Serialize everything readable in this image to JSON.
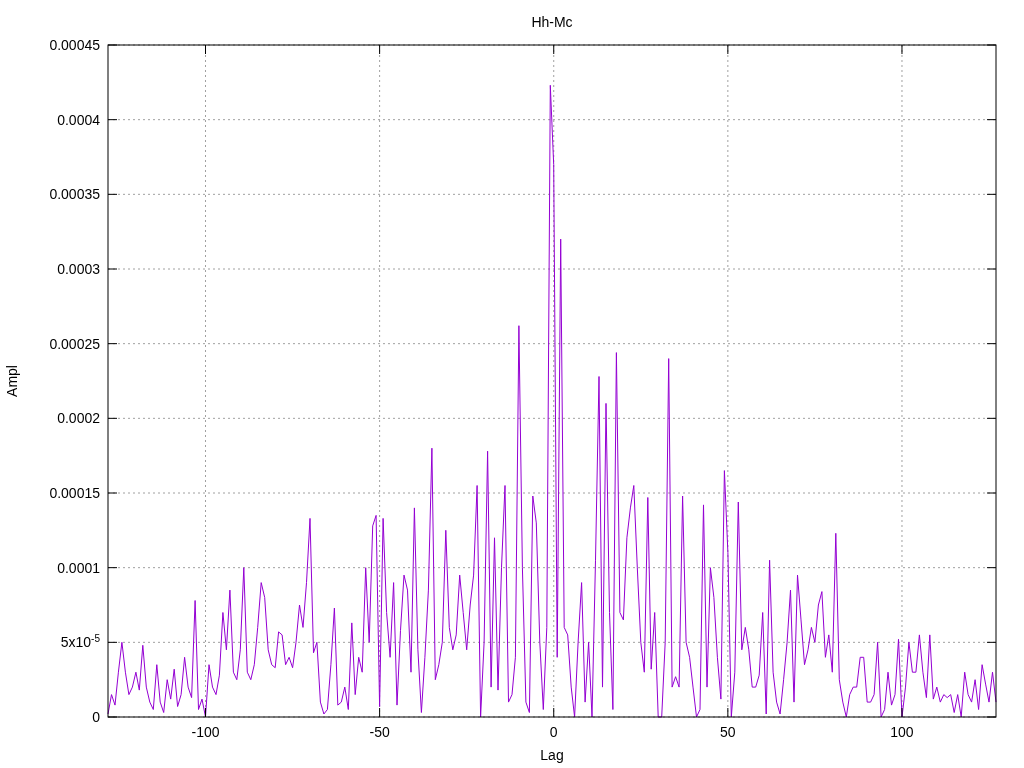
{
  "chart_data": {
    "type": "line",
    "grid": true,
    "title": "Hh-Mc",
    "xlabel": "Lag",
    "ylabel": "Ampl",
    "xlim": [
      -128,
      127
    ],
    "ylim": [
      0,
      0.00045
    ],
    "xticks": [
      -100,
      -50,
      0,
      50,
      100
    ],
    "yticks": [
      0,
      {
        "value": 5e-05,
        "label": "5x10$^{-5}$"
      },
      0.0001,
      0.00015,
      0.0002,
      0.00025,
      0.0003,
      0.00035,
      0.0004,
      0.00045
    ],
    "x": [
      -128,
      -127,
      -126,
      -125,
      -124,
      -123,
      -122,
      -121,
      -120,
      -119,
      -118,
      -117,
      -116,
      -115,
      -114,
      -113,
      -112,
      -111,
      -110,
      -109,
      -108,
      -107,
      -106,
      -105,
      -104,
      -103,
      -102,
      -101,
      -100,
      -99,
      -98,
      -97,
      -96,
      -95,
      -94,
      -93,
      -92,
      -91,
      -90,
      -89,
      -88,
      -87,
      -86,
      -85,
      -84,
      -83,
      -82,
      -81,
      -80,
      -79,
      -78,
      -77,
      -76,
      -75,
      -74,
      -73,
      -72,
      -71,
      -70,
      -69,
      -68,
      -67,
      -66,
      -65,
      -64,
      -63,
      -62,
      -61,
      -60,
      -59,
      -58,
      -57,
      -56,
      -55,
      -54,
      -53,
      -52,
      -51,
      -50,
      -49,
      -48,
      -47,
      -46,
      -45,
      -44,
      -43,
      -42,
      -41,
      -40,
      -39,
      -38,
      -37,
      -36,
      -35,
      -34,
      -33,
      -32,
      -31,
      -30,
      -29,
      -28,
      -27,
      -26,
      -25,
      -24,
      -23,
      -22,
      -21,
      -20,
      -19,
      -18,
      -17,
      -16,
      -15,
      -14,
      -13,
      -12,
      -11,
      -10,
      -9,
      -8,
      -7,
      -6,
      -5,
      -4,
      -3,
      -2,
      -1,
      0,
      1,
      2,
      3,
      4,
      5,
      6,
      7,
      8,
      9,
      10,
      11,
      12,
      13,
      14,
      15,
      16,
      17,
      18,
      19,
      20,
      21,
      22,
      23,
      24,
      25,
      26,
      27,
      28,
      29,
      30,
      31,
      32,
      33,
      34,
      35,
      36,
      37,
      38,
      39,
      40,
      41,
      42,
      43,
      44,
      45,
      46,
      47,
      48,
      49,
      50,
      51,
      52,
      53,
      54,
      55,
      56,
      57,
      58,
      59,
      60,
      61,
      62,
      63,
      64,
      65,
      66,
      67,
      68,
      69,
      70,
      71,
      72,
      73,
      74,
      75,
      76,
      77,
      78,
      79,
      80,
      81,
      82,
      83,
      84,
      85,
      86,
      87,
      88,
      89,
      90,
      91,
      92,
      93,
      94,
      95,
      96,
      97,
      98,
      99,
      100,
      101,
      102,
      103,
      104,
      105,
      106,
      107,
      108,
      109,
      110,
      111,
      112,
      113,
      114,
      115,
      116,
      117,
      118,
      119,
      120,
      121,
      122,
      123,
      124,
      125,
      126,
      127
    ],
    "series": [
      {
        "color": "#9400d3",
        "values": [
          2e-06,
          1.5e-05,
          8e-06,
          3e-05,
          5e-05,
          3e-05,
          1.5e-05,
          2e-05,
          3e-05,
          1.8e-05,
          4.8e-05,
          2e-05,
          1e-05,
          5e-06,
          3.5e-05,
          1e-05,
          3e-06,
          2.5e-05,
          1.2e-05,
          3.2e-05,
          7e-06,
          1.5e-05,
          4e-05,
          2e-05,
          1.3e-05,
          7.8e-05,
          5e-06,
          1.2e-05,
          0,
          3.5e-05,
          2e-05,
          1.5e-05,
          2.8e-05,
          7e-05,
          4.5e-05,
          8.5e-05,
          3e-05,
          2.5e-05,
          4.5e-05,
          0.0001,
          3e-05,
          2.5e-05,
          3.5e-05,
          6e-05,
          9e-05,
          8e-05,
          4.5e-05,
          3.5e-05,
          3.3e-05,
          5.7e-05,
          5.5e-05,
          3.5e-05,
          4e-05,
          3.3e-05,
          5e-05,
          7.5e-05,
          6e-05,
          9e-05,
          0.000133,
          4.3e-05,
          5e-05,
          1e-05,
          2e-06,
          5e-06,
          3.5e-05,
          7.3e-05,
          8e-06,
          1e-05,
          2e-05,
          5e-06,
          6.3e-05,
          1.5e-05,
          4e-05,
          3e-05,
          0.0001,
          5e-05,
          0.000128,
          0.000135,
          7e-06,
          0.000133,
          7e-05,
          4e-05,
          9e-05,
          8e-06,
          5.8e-05,
          9.5e-05,
          8.5e-05,
          3e-05,
          0.00014,
          4.5e-05,
          3e-06,
          4e-05,
          8.5e-05,
          0.00018,
          2.5e-05,
          3.5e-05,
          5e-05,
          0.000125,
          6e-05,
          4.5e-05,
          5.5e-05,
          9.5e-05,
          7e-05,
          4.5e-05,
          7.5e-05,
          9.5e-05,
          0.000155,
          0,
          5e-05,
          0.000178,
          2e-05,
          0.00012,
          1.8e-05,
          0.0001,
          0.000155,
          1e-05,
          1.5e-05,
          4e-05,
          0.000262,
          0.0001,
          1e-05,
          3e-06,
          0.000148,
          0.00013,
          5e-05,
          5e-06,
          6e-05,
          0.000423,
          0.00037,
          4e-05,
          0.00032,
          6e-05,
          5.5e-05,
          2e-05,
          0,
          5e-05,
          9e-05,
          1e-05,
          5e-05,
          0,
          0.000105,
          0.000228,
          2e-05,
          0.00021,
          7e-05,
          5e-06,
          0.000244,
          7e-05,
          6.5e-05,
          0.00012,
          0.00014,
          0.000155,
          0.0001,
          5e-05,
          3e-05,
          0.000147,
          3.2e-05,
          7e-05,
          0,
          0,
          5e-05,
          0.00024,
          2e-05,
          2.7e-05,
          2e-05,
          0.000148,
          5e-05,
          4e-05,
          2e-05,
          0,
          5e-06,
          0.000142,
          2e-05,
          0.0001,
          8e-05,
          4e-05,
          1.2e-05,
          0.000165,
          0.00011,
          0,
          3e-05,
          0.000144,
          4.5e-05,
          6e-05,
          4.5e-05,
          2e-05,
          2e-05,
          2.8e-05,
          7e-05,
          2e-06,
          0.000105,
          3e-05,
          1e-05,
          2e-06,
          2.5e-05,
          5e-05,
          8.5e-05,
          1e-05,
          9.5e-05,
          6.5e-05,
          3.5e-05,
          4.5e-05,
          6e-05,
          5e-05,
          7.5e-05,
          8.4e-05,
          4e-05,
          5.5e-05,
          3e-05,
          0.000123,
          2.5e-05,
          1e-05,
          0,
          1.5e-05,
          2e-05,
          2e-05,
          4e-05,
          4e-05,
          1e-05,
          1e-05,
          1.5e-05,
          5e-05,
          0,
          5e-06,
          3e-05,
          8e-06,
          1.5e-05,
          5.2e-05,
          0,
          2e-05,
          5e-05,
          3e-05,
          3e-05,
          5.5e-05,
          3e-05,
          1.3e-05,
          5.5e-05,
          1.2e-05,
          2e-05,
          1e-05,
          1.5e-05,
          1.3e-05,
          1.5e-05,
          3e-06,
          1.5e-05,
          0,
          3e-05,
          1.5e-05,
          1e-05,
          2.5e-05,
          5e-06,
          3.5e-05,
          2.2e-05,
          1e-05,
          3e-05,
          1e-05
        ]
      }
    ]
  }
}
